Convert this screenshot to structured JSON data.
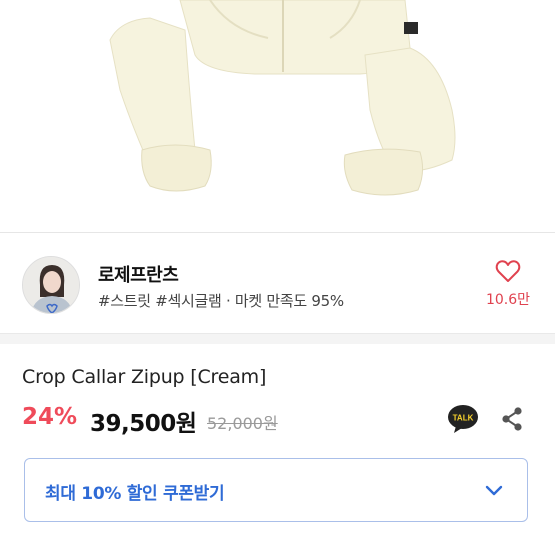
{
  "shop": {
    "name": "로제프란츠",
    "tags": "#스트릿 #섹시글램 · 마켓 만족도 95%",
    "like_count": "10.6만"
  },
  "product": {
    "title": "Crop Callar Zipup [Cream]",
    "discount": "24%",
    "price": "39,500원",
    "original_price": "52,000원"
  },
  "coupon": {
    "label": "최대 10% 할인 쿠폰받기"
  },
  "icons": {
    "talk_badge": "TALK",
    "like": "heart-icon",
    "share": "share-icon",
    "expand": "chevron-down-icon"
  },
  "colors": {
    "accent_red": "#ef4b5a",
    "accent_blue": "#2f6bd6",
    "talk_bg": "#222222"
  }
}
